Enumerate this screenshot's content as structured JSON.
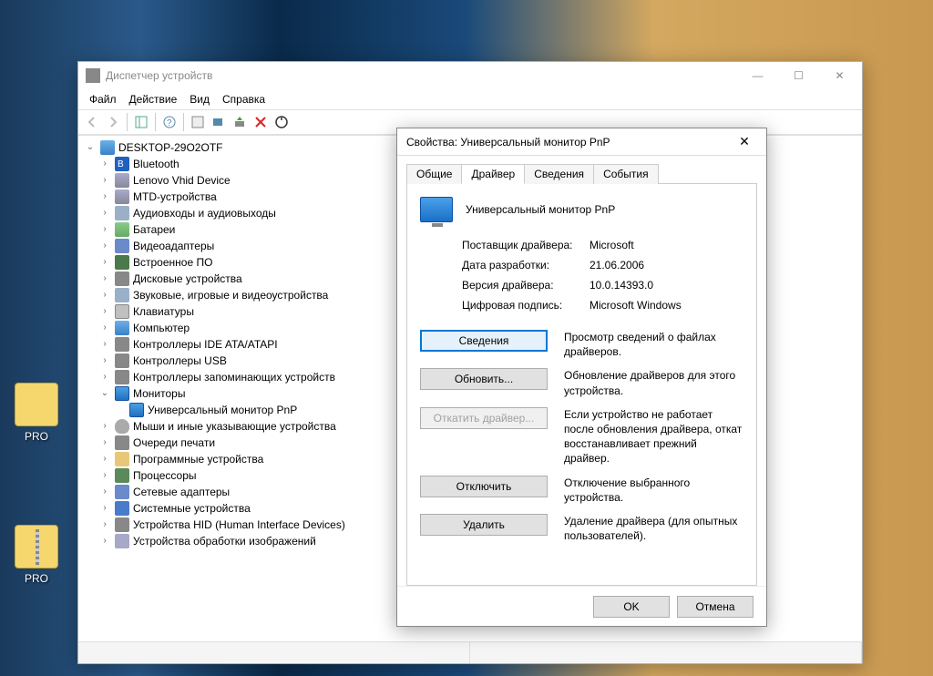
{
  "desktop_icons": [
    {
      "label": "PRO",
      "type": "folder"
    },
    {
      "label": "PRO",
      "type": "zip"
    }
  ],
  "device_manager": {
    "title": "Диспетчер устройств",
    "menu": [
      "Файл",
      "Действие",
      "Вид",
      "Справка"
    ],
    "root": "DESKTOP-29O2OTF",
    "categories": [
      {
        "label": "Bluetooth",
        "icon": "i-bt"
      },
      {
        "label": "Lenovo Vhid Device",
        "icon": "i-dev"
      },
      {
        "label": "MTD-устройства",
        "icon": "i-dev"
      },
      {
        "label": "Аудиовходы и аудиовыходы",
        "icon": "i-snd"
      },
      {
        "label": "Батареи",
        "icon": "i-batt"
      },
      {
        "label": "Видеоадаптеры",
        "icon": "i-vid"
      },
      {
        "label": "Встроенное ПО",
        "icon": "i-chip"
      },
      {
        "label": "Дисковые устройства",
        "icon": "i-disk"
      },
      {
        "label": "Звуковые, игровые и видеоустройства",
        "icon": "i-snd"
      },
      {
        "label": "Клавиатуры",
        "icon": "i-kbd"
      },
      {
        "label": "Компьютер",
        "icon": "i-pc"
      },
      {
        "label": "Контроллеры IDE ATA/ATAPI",
        "icon": "i-disk"
      },
      {
        "label": "Контроллеры USB",
        "icon": "i-usb"
      },
      {
        "label": "Контроллеры запоминающих устройств",
        "icon": "i-disk"
      },
      {
        "label": "Мониторы",
        "icon": "i-mon",
        "expanded": true,
        "children": [
          {
            "label": "Универсальный монитор PnP",
            "icon": "i-mon"
          }
        ]
      },
      {
        "label": "Мыши и иные указывающие устройства",
        "icon": "i-mouse"
      },
      {
        "label": "Очереди печати",
        "icon": "i-prn"
      },
      {
        "label": "Программные устройства",
        "icon": "i-sw"
      },
      {
        "label": "Процессоры",
        "icon": "i-cpu"
      },
      {
        "label": "Сетевые адаптеры",
        "icon": "i-net"
      },
      {
        "label": "Системные устройства",
        "icon": "i-sys"
      },
      {
        "label": "Устройства HID (Human Interface Devices)",
        "icon": "i-hid"
      },
      {
        "label": "Устройства обработки изображений",
        "icon": "i-img"
      }
    ]
  },
  "properties": {
    "title": "Свойства: Универсальный монитор PnP",
    "tabs": [
      "Общие",
      "Драйвер",
      "Сведения",
      "События"
    ],
    "active_tab": 1,
    "device_name": "Универсальный монитор PnP",
    "rows": [
      {
        "label": "Поставщик драйвера:",
        "value": "Microsoft"
      },
      {
        "label": "Дата разработки:",
        "value": "21.06.2006"
      },
      {
        "label": "Версия драйвера:",
        "value": "10.0.14393.0"
      },
      {
        "label": "Цифровая подпись:",
        "value": "Microsoft Windows"
      }
    ],
    "actions": [
      {
        "label": "Сведения",
        "desc": "Просмотр сведений о файлах драйверов.",
        "focus": true,
        "disabled": false
      },
      {
        "label": "Обновить...",
        "desc": "Обновление драйверов для этого устройства.",
        "disabled": false
      },
      {
        "label": "Откатить драйвер...",
        "desc": "Если устройство не работает после обновления драйвера, откат восстанавливает прежний драйвер.",
        "disabled": true
      },
      {
        "label": "Отключить",
        "desc": "Отключение выбранного устройства.",
        "disabled": false
      },
      {
        "label": "Удалить",
        "desc": "Удаление драйвера (для опытных пользователей).",
        "disabled": false
      }
    ],
    "footer": {
      "ok": "OK",
      "cancel": "Отмена"
    }
  }
}
